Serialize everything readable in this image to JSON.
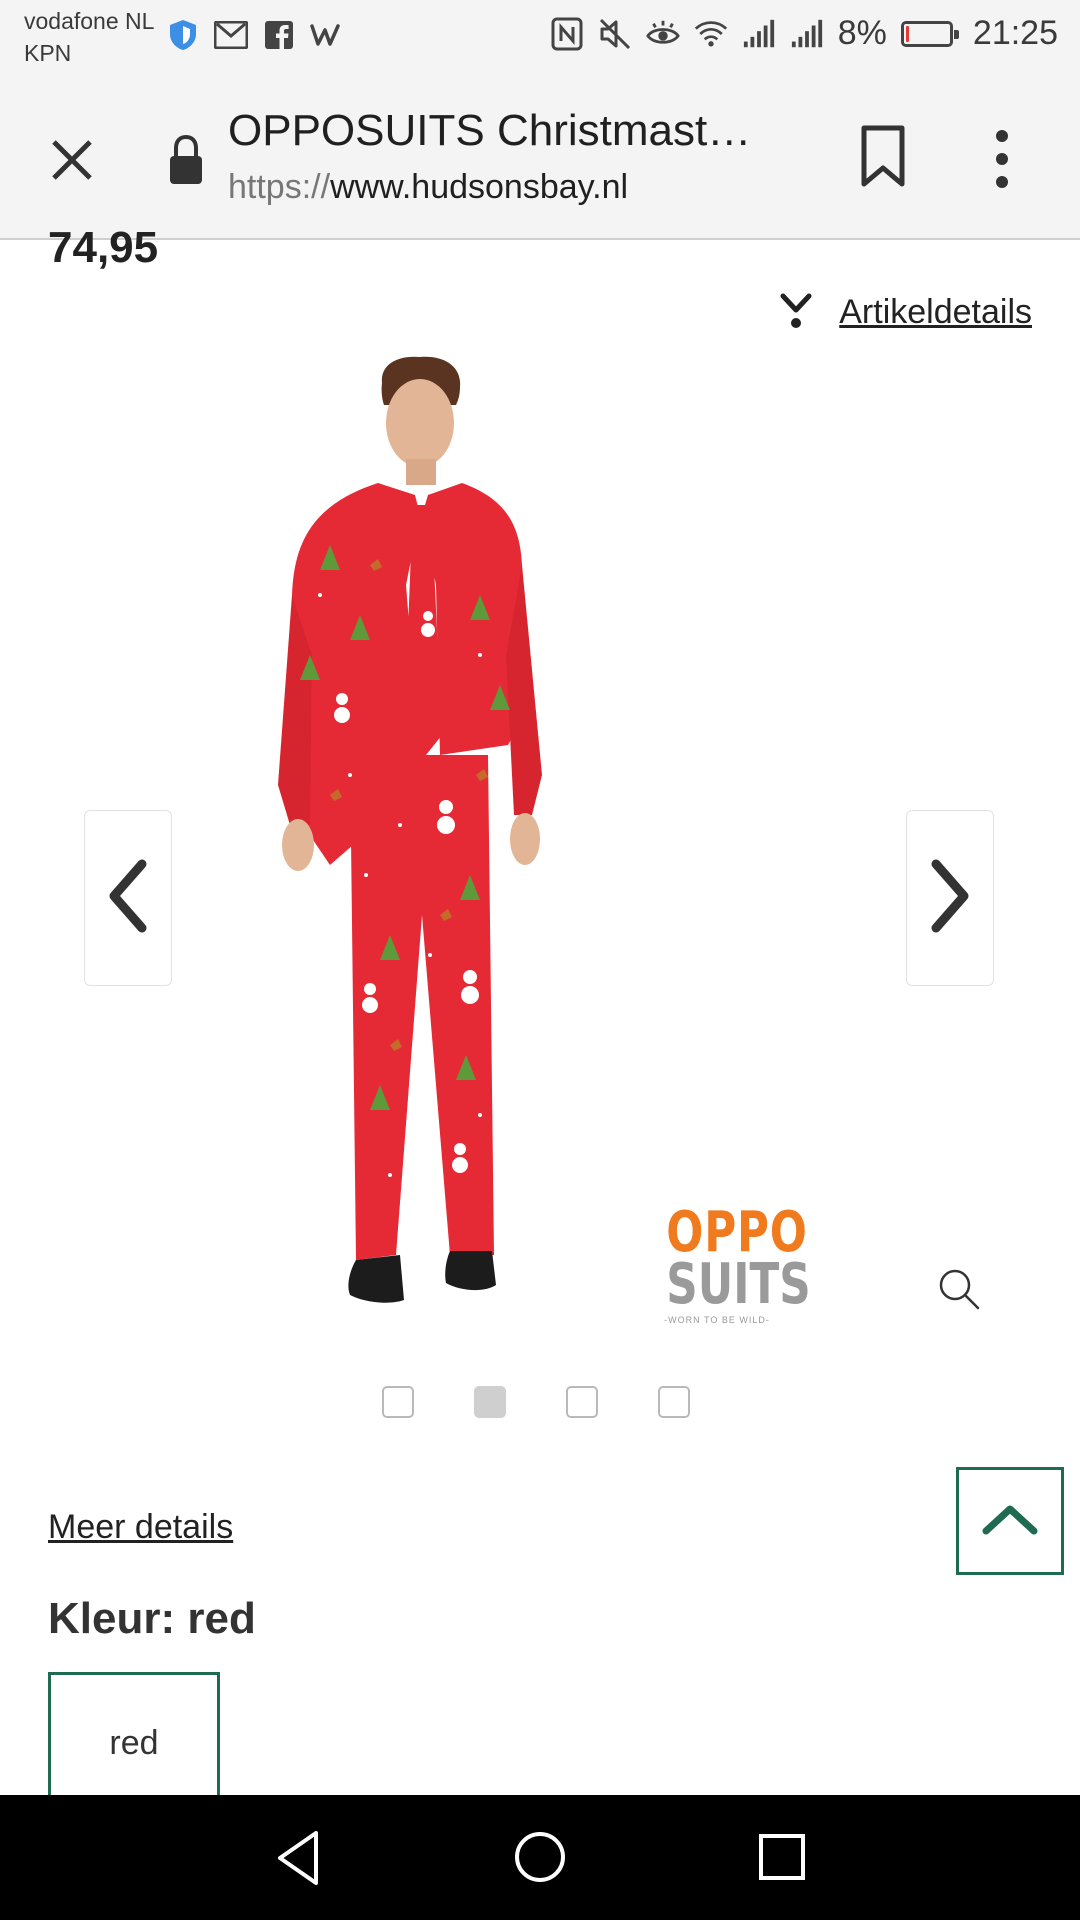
{
  "status_bar": {
    "carrier_primary": "vodafone NL",
    "carrier_secondary": "KPN",
    "battery_percent": "8%",
    "battery_level": 0.08,
    "time": "21:25",
    "icons_left": [
      "shield-app-icon",
      "gmail-icon",
      "facebook-icon",
      "wish-icon"
    ],
    "icons_right": [
      "nfc-icon",
      "mute-icon",
      "eye-comfort-icon",
      "wifi-icon",
      "signal-icon",
      "signal-icon"
    ]
  },
  "browser": {
    "close_icon": "close-icon",
    "lock_icon": "lock-icon",
    "page_title": "OPPOSUITS Christmast…",
    "url_scheme": "https://",
    "url_host": "www.hudsonsbay.nl",
    "bookmark_icon": "bookmark-icon",
    "menu_icon": "more-vert-icon"
  },
  "product": {
    "price": "74,95",
    "details_toggle_label": "Artikeldetails",
    "image_alt": "Man in red Christmas suit",
    "brand_logo": {
      "line1": "OPPO",
      "line2": "SUITS",
      "tagline": "-WORN TO BE WILD-"
    },
    "carousel": {
      "count": 4,
      "active_index": 1
    },
    "more_details_label": "Meer details",
    "color_heading": "Kleur: red",
    "color_option": "red"
  },
  "colors": {
    "accent_green": "#1e6b52",
    "suit_red": "#e52a35",
    "logo_orange": "#f07b1f",
    "battery_red": "#e53935"
  }
}
